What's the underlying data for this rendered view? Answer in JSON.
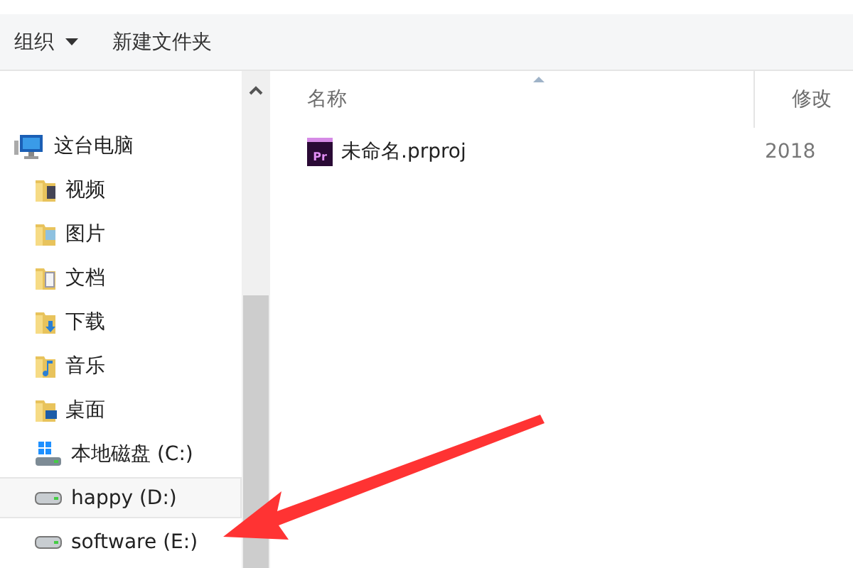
{
  "toolbar": {
    "buttons": [
      {
        "label": "组织",
        "kind": "menu"
      },
      {
        "label": "新建文件夹",
        "kind": "plain"
      }
    ]
  },
  "nav": {
    "root": {
      "label": "这台电脑",
      "kind": "pc",
      "selected": false,
      "children": [
        {
          "label": "视频",
          "kind": "video",
          "selected": false
        },
        {
          "label": "图片",
          "kind": "pictures",
          "selected": false
        },
        {
          "label": "文档",
          "kind": "documents",
          "selected": false
        },
        {
          "label": "下载",
          "kind": "downloads",
          "selected": false
        },
        {
          "label": "音乐",
          "kind": "music",
          "selected": false
        },
        {
          "label": "桌面",
          "kind": "desktop",
          "selected": false
        },
        {
          "label": "本地磁盘 (C:)",
          "kind": "system-drive",
          "selected": false
        },
        {
          "label": "happy (D:)",
          "kind": "drive",
          "selected": true
        },
        {
          "label": "software (E:)",
          "kind": "drive",
          "selected": false
        }
      ]
    }
  },
  "table": {
    "columns": [
      {
        "label": "名称",
        "sorted": true
      },
      {
        "label": "修改",
        "sorted": false
      }
    ],
    "rows": [
      {
        "name": "未命名.prproj",
        "badge": "Pr",
        "modified": "2018"
      }
    ]
  }
}
